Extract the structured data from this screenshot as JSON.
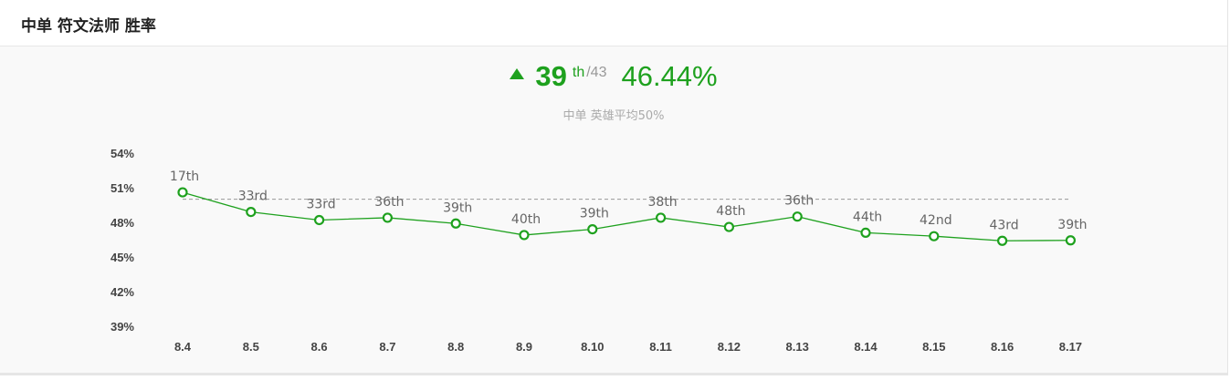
{
  "header": {
    "title": "中单 符文法师 胜率"
  },
  "summary": {
    "rank": "39",
    "rank_suffix": "th",
    "rank_total": "/43",
    "win_rate": "46.44%",
    "trend": "up",
    "subtitle": "中单 英雄平均50%"
  },
  "colors": {
    "accent": "#1ea11e",
    "average_line": "#999999"
  },
  "chart_data": {
    "type": "line",
    "title": "",
    "xlabel": "",
    "ylabel": "",
    "categories": [
      "8.4",
      "8.5",
      "8.6",
      "8.7",
      "8.8",
      "8.9",
      "8.10",
      "8.11",
      "8.12",
      "8.13",
      "8.14",
      "8.15",
      "8.16",
      "8.17"
    ],
    "y_tick_labels": [
      "54%",
      "51%",
      "48%",
      "45%",
      "42%",
      "39%"
    ],
    "y_ticks": [
      54,
      51,
      48,
      45,
      42,
      39
    ],
    "ylim": [
      39,
      54
    ],
    "series": [
      {
        "values": [
          50.6,
          48.9,
          48.2,
          48.4,
          47.9,
          46.9,
          47.4,
          48.4,
          47.6,
          48.5,
          47.1,
          46.8,
          46.4,
          46.44
        ],
        "point_labels": [
          "17th",
          "33rd",
          "33rd",
          "36th",
          "39th",
          "40th",
          "39th",
          "38th",
          "48th",
          "36th",
          "44th",
          "42nd",
          "43rd",
          "39th"
        ]
      }
    ],
    "reference_line": 50,
    "grid": false
  }
}
